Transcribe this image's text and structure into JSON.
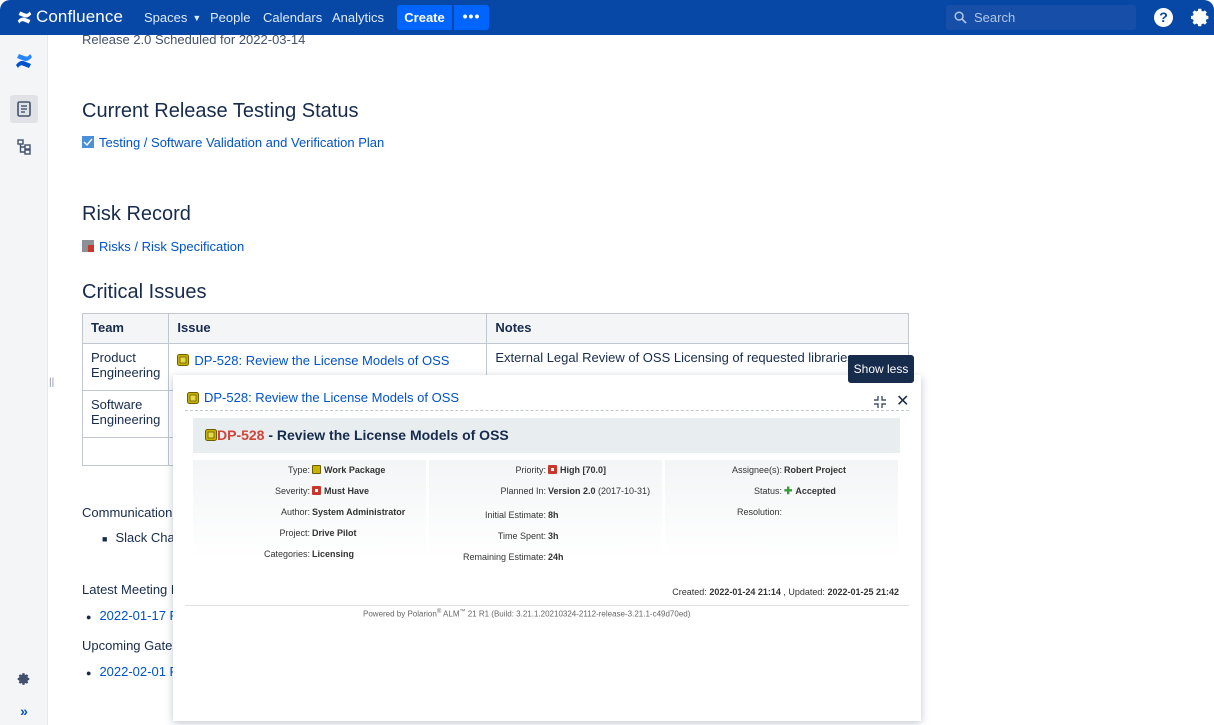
{
  "nav": {
    "brand": "Confluence",
    "spaces": "Spaces",
    "people": "People",
    "calendars": "Calendars",
    "analytics": "Analytics",
    "create": "Create",
    "more": "•••",
    "search_placeholder": "Search",
    "help": "?"
  },
  "page": {
    "scheduled_line": "Release 2.0 Scheduled for 2022-03-14",
    "section_testing": "Current Release Testing Status",
    "testing_link": "Testing / Software Validation and Verification Plan",
    "section_risk": "Risk Record",
    "risk_link": "Risks / Risk Specification",
    "section_issues": "Critical Issues",
    "communication": "Communication C",
    "slack": "Slack Chan",
    "latest_meeting": "Latest Meeting M",
    "latest_meeting_link": "2022-01-17 Pr",
    "upcoming_gate": "Upcoming Gate F",
    "upcoming_gate_link": "2022-02-01 Pr"
  },
  "table": {
    "headers": [
      "Team",
      "Issue",
      "Notes"
    ],
    "rows": [
      {
        "team": "Product Engineering",
        "issue": "DP-528: Review the License Models of OSS",
        "notes": "External Legal Review of OSS Licensing of requested libraries"
      },
      {
        "team": "Software Engineering",
        "issue": "",
        "notes": ""
      },
      {
        "team": "",
        "issue": "",
        "notes": ""
      }
    ]
  },
  "popup": {
    "title": "DP-528: Review the License Models of OSS",
    "tooltip": "Show less",
    "close": "✕",
    "header_id": "DP-528",
    "header_title": " - Review the License Models of OSS",
    "col1": [
      {
        "label": "Type:",
        "value": "Work Package"
      },
      {
        "label": "Severity:",
        "value": "Must Have"
      },
      {
        "label": "Author:",
        "value": "System Administrator"
      },
      {
        "label": "Project:",
        "value": "Drive Pilot"
      },
      {
        "label": "Categories:",
        "value": "Licensing"
      }
    ],
    "col2": [
      {
        "label": "Priority:",
        "value": "High [70.0]"
      },
      {
        "label": "Planned In:",
        "value": "Version 2.0",
        "extra": " (2017-10-31)"
      },
      {
        "label": "Initial Estimate:",
        "value": "8h"
      },
      {
        "label": "Time Spent:",
        "value": "3h"
      },
      {
        "label": "Remaining Estimate:",
        "value": "24h"
      }
    ],
    "col3": [
      {
        "label": "Assignee(s):",
        "value": "Robert Project"
      },
      {
        "label": "Status:",
        "value": "Accepted"
      },
      {
        "label": "Resolution:",
        "value": ""
      }
    ],
    "created_label": "Created:",
    "created": "2022-01-24 21:14",
    "updated_label": ", Updated:",
    "updated": "2022-01-25 21:42",
    "powered_pre": "Powered by Polarion",
    "powered_mid": " ALM",
    "powered_post": " 21 R1 (Build: 3.21.1.20210324-2112-release-3.21.1-c49d70ed)"
  },
  "colors": {
    "nav_bg": "#0747a6",
    "link": "#0052cc",
    "issue_id_red": "#d04437"
  }
}
